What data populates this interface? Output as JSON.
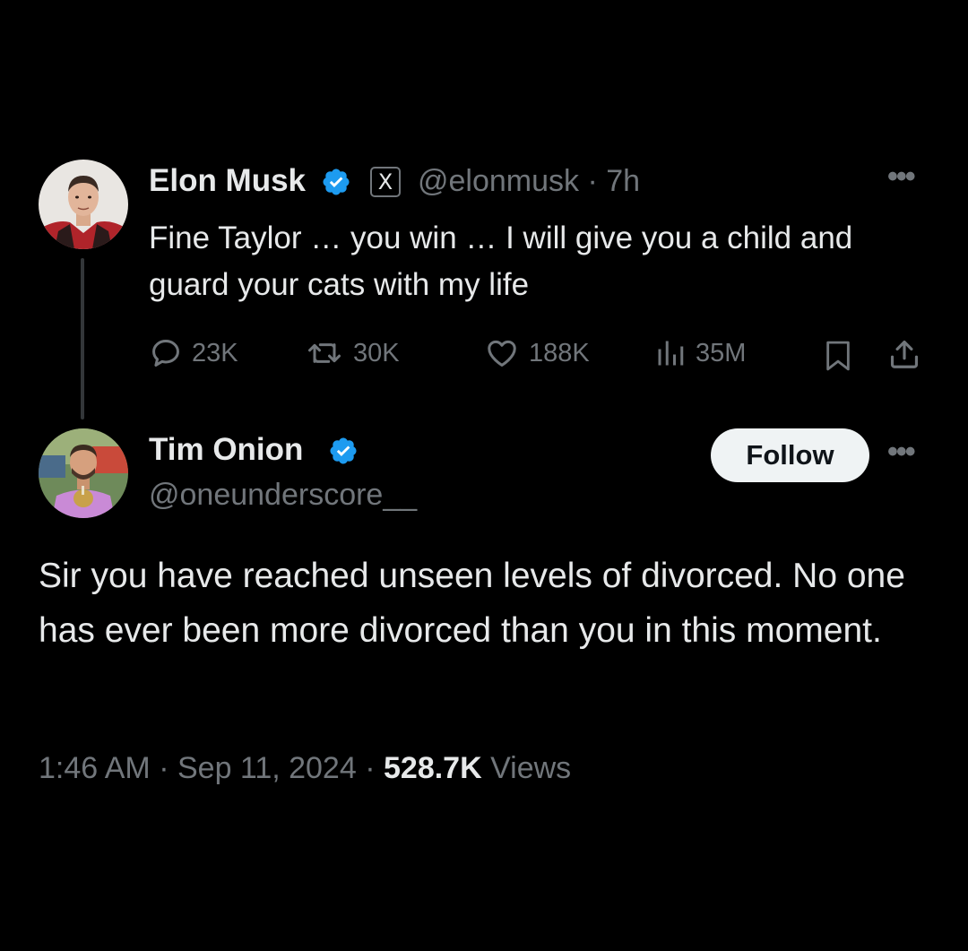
{
  "parent_tweet": {
    "author_name": "Elon Musk",
    "verified": true,
    "affiliate_badge": "X",
    "handle": "@elonmusk",
    "separator": "·",
    "time": "7h",
    "more_label": "•••",
    "text": "Fine Taylor … you win … I will give you a child and guard your cats with my life",
    "actions": {
      "replies": "23K",
      "reposts": "30K",
      "likes": "188K",
      "views": "35M"
    },
    "icons": {
      "reply": "reply-bubble-icon",
      "repost": "repost-icon",
      "like": "heart-icon",
      "views": "analytics-bars-icon",
      "bookmark": "bookmark-icon",
      "share": "share-upload-icon"
    }
  },
  "reply_tweet": {
    "author_name": "Tim Onion",
    "verified": true,
    "handle": "@oneunderscore__",
    "follow_label": "Follow",
    "more_label": "•••",
    "text": "Sir you have reached unseen levels of divorced. No one has ever been more divorced than you in this moment.",
    "time": "1:46 AM",
    "date": "Sep 11, 2024",
    "separator": "·",
    "views_count": "528.7K",
    "views_label": "Views"
  },
  "colors": {
    "background": "#000000",
    "primary_text": "#e7e9ea",
    "secondary_text": "#71767b",
    "verified_blue": "#1d9bf0",
    "follow_button_bg": "#eff3f4",
    "thread_line": "#333639"
  }
}
